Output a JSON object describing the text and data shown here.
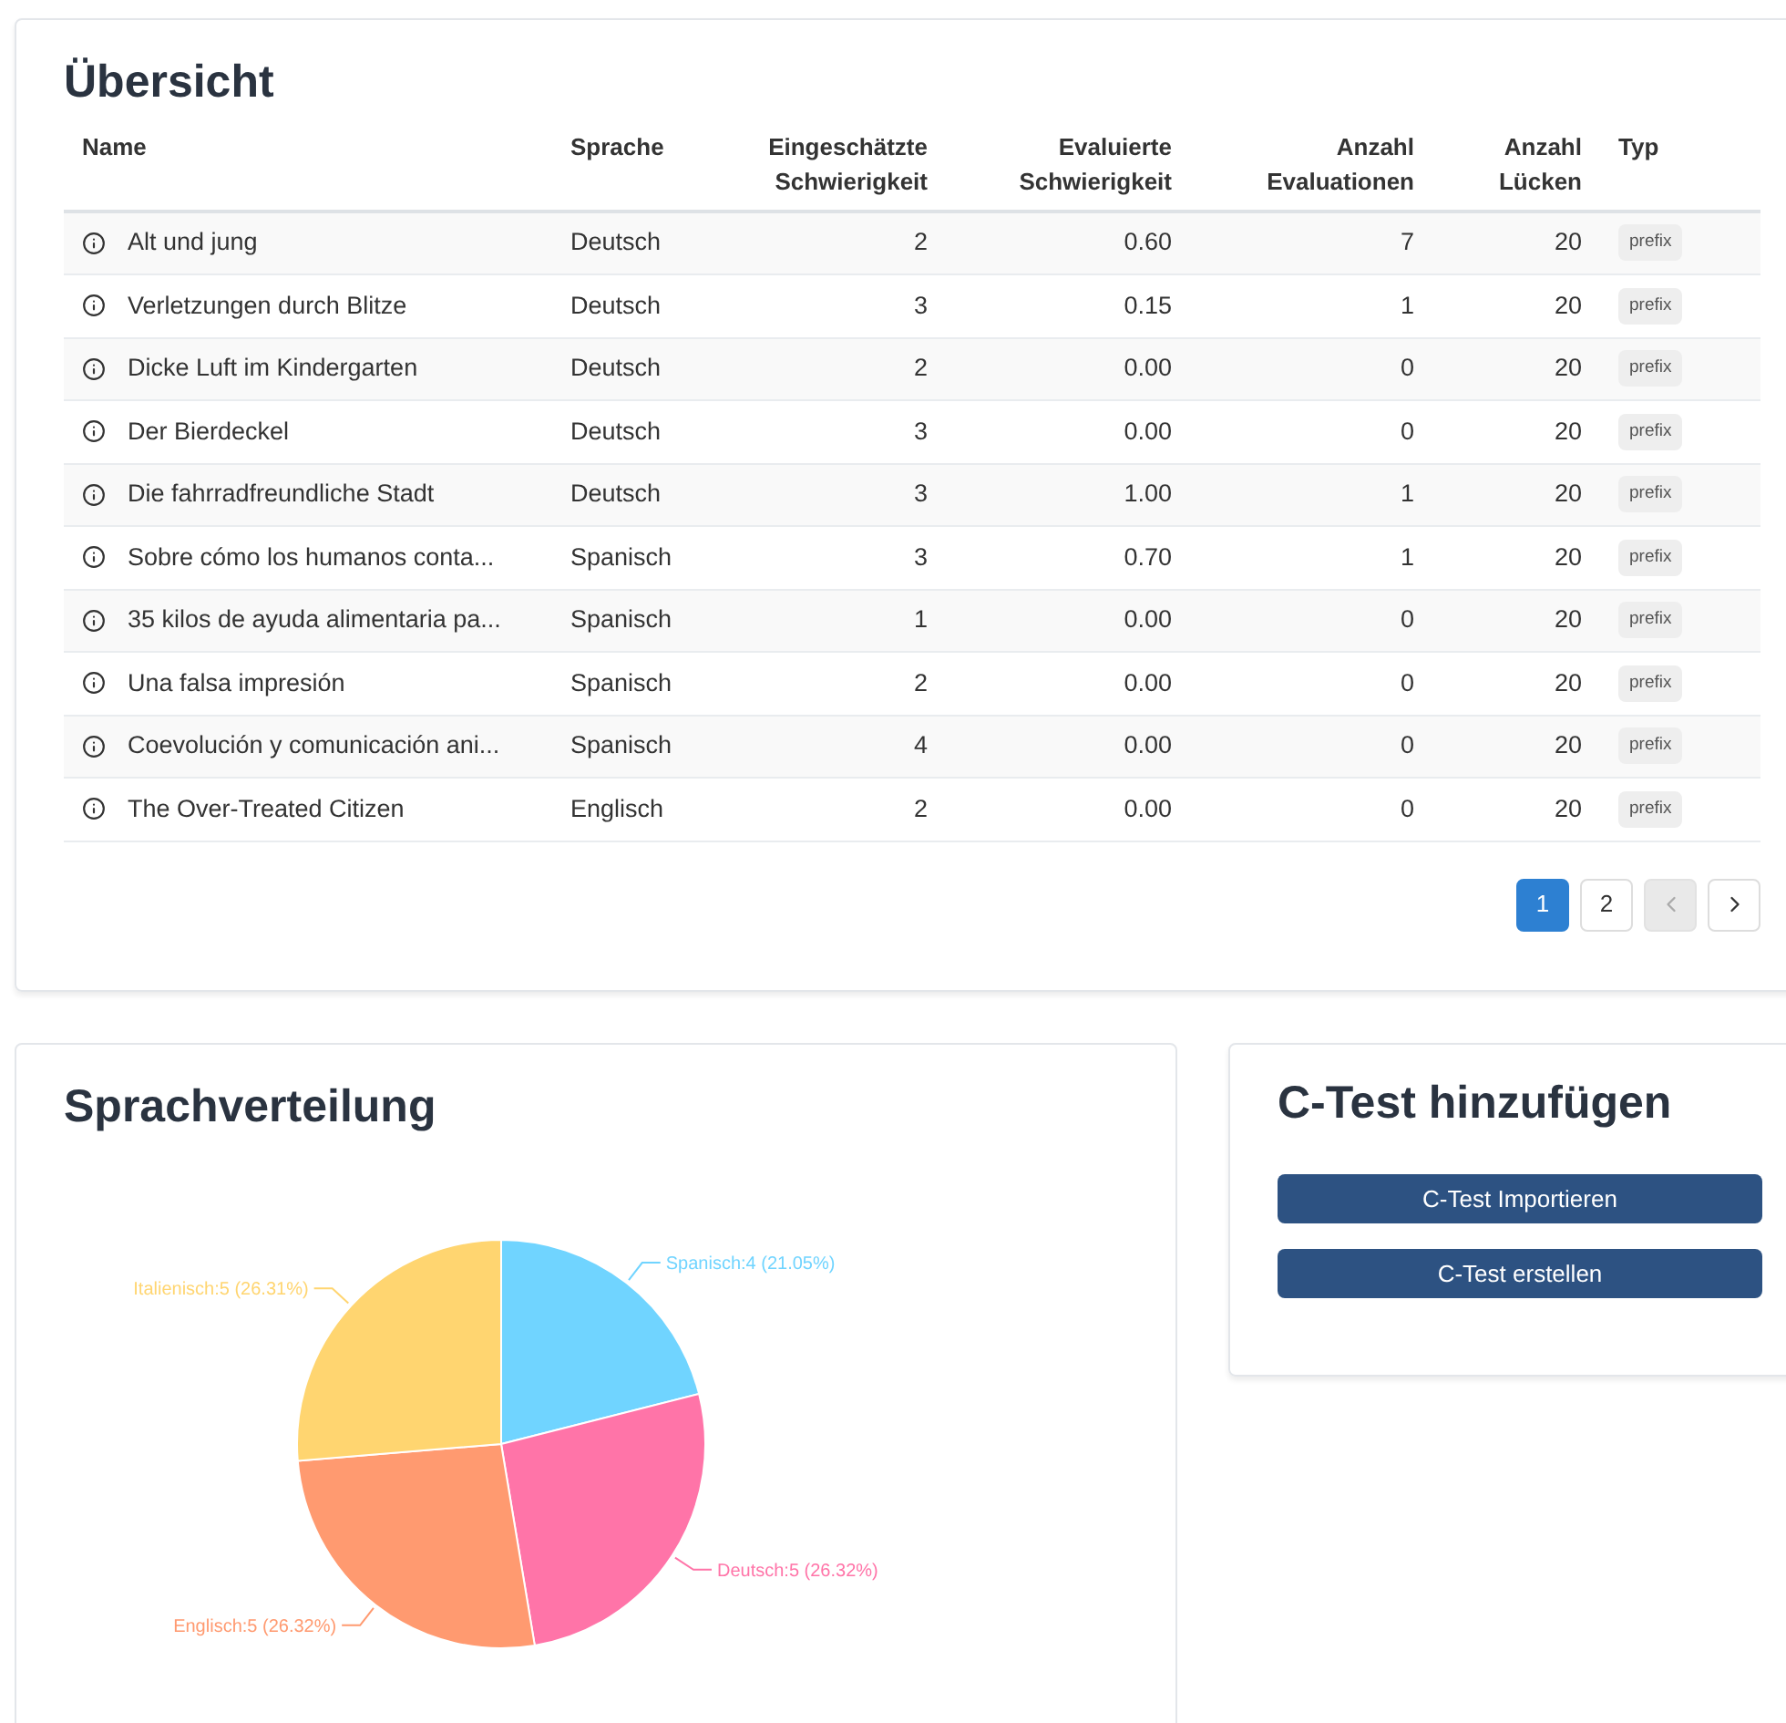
{
  "overview": {
    "title": "Übersicht",
    "columns": [
      "Name",
      "Sprache",
      "Eingeschätzte Schwierigkeit",
      "Evaluierte Schwierigkeit",
      "Anzahl Evaluationen",
      "Anzahl Lücken",
      "Typ"
    ],
    "rows": [
      {
        "name": "Alt und jung",
        "language": "Deutsch",
        "estimated": "2",
        "evaluated": "0.60",
        "evaluations": "7",
        "gaps": "20",
        "type": "prefix"
      },
      {
        "name": "Verletzungen durch Blitze",
        "language": "Deutsch",
        "estimated": "3",
        "evaluated": "0.15",
        "evaluations": "1",
        "gaps": "20",
        "type": "prefix"
      },
      {
        "name": "Dicke Luft im Kindergarten",
        "language": "Deutsch",
        "estimated": "2",
        "evaluated": "0.00",
        "evaluations": "0",
        "gaps": "20",
        "type": "prefix"
      },
      {
        "name": "Der Bierdeckel",
        "language": "Deutsch",
        "estimated": "3",
        "evaluated": "0.00",
        "evaluations": "0",
        "gaps": "20",
        "type": "prefix"
      },
      {
        "name": "Die fahrradfreundliche Stadt",
        "language": "Deutsch",
        "estimated": "3",
        "evaluated": "1.00",
        "evaluations": "1",
        "gaps": "20",
        "type": "prefix"
      },
      {
        "name": "Sobre cómo los humanos conta...",
        "language": "Spanisch",
        "estimated": "3",
        "evaluated": "0.70",
        "evaluations": "1",
        "gaps": "20",
        "type": "prefix"
      },
      {
        "name": "35 kilos de ayuda alimentaria pa...",
        "language": "Spanisch",
        "estimated": "1",
        "evaluated": "0.00",
        "evaluations": "0",
        "gaps": "20",
        "type": "prefix"
      },
      {
        "name": "Una falsa impresión",
        "language": "Spanisch",
        "estimated": "2",
        "evaluated": "0.00",
        "evaluations": "0",
        "gaps": "20",
        "type": "prefix"
      },
      {
        "name": "Coevolución y comunicación ani...",
        "language": "Spanisch",
        "estimated": "4",
        "evaluated": "0.00",
        "evaluations": "0",
        "gaps": "20",
        "type": "prefix"
      },
      {
        "name": "The Over-Treated Citizen",
        "language": "Englisch",
        "estimated": "2",
        "evaluated": "0.00",
        "evaluations": "0",
        "gaps": "20",
        "type": "prefix"
      }
    ],
    "pagination": [
      {
        "kind": "page",
        "label": "1",
        "selected": true,
        "disabled": false
      },
      {
        "kind": "page",
        "label": "2",
        "selected": false,
        "disabled": false
      },
      {
        "kind": "prev",
        "selected": false,
        "disabled": true
      },
      {
        "kind": "next",
        "selected": false,
        "disabled": false
      }
    ]
  },
  "distribution": {
    "title": "Sprachverteilung",
    "chart_data": {
      "type": "pie",
      "series": [
        {
          "colors": [
            "#70d4ff",
            "#ff74a8",
            "#ff9a70",
            "#ffd570"
          ],
          "values": [
            21.05,
            26.32,
            26.32,
            26.31
          ]
        }
      ],
      "value_labels": [
        "Spanisch:4 (21.05%)",
        "Deutsch:5 (26.32%)",
        "Englisch:5 (26.32%)",
        "Italienisch:5 (26.31%)"
      ]
    }
  },
  "add_test": {
    "title": "C-Test hinzufügen",
    "buttons": [
      "C-Test Importieren",
      "C-Test erstellen"
    ]
  }
}
